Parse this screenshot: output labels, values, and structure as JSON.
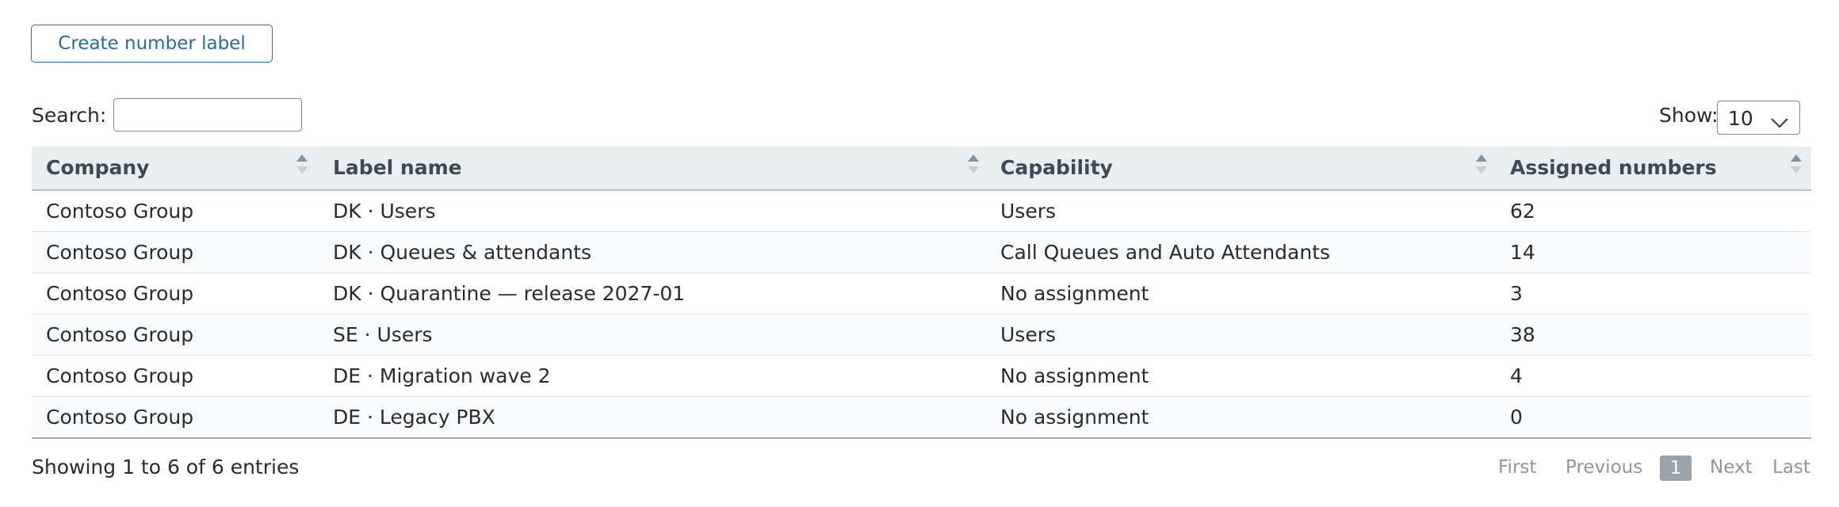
{
  "toolbar": {
    "create_label": "Create number label"
  },
  "search": {
    "label": "Search:",
    "value": "",
    "placeholder": ""
  },
  "page_size": {
    "label": "Show:",
    "value": "10"
  },
  "table": {
    "columns": [
      "Company",
      "Label name",
      "Capability",
      "Assigned numbers"
    ],
    "rows": [
      [
        "Contoso Group",
        "DK · Users",
        "Users",
        "62"
      ],
      [
        "Contoso Group",
        "DK · Queues & attendants",
        "Call Queues and Auto Attendants",
        "14"
      ],
      [
        "Contoso Group",
        "DK · Quarantine — release 2027-01",
        "No assignment",
        "3"
      ],
      [
        "Contoso Group",
        "SE · Users",
        "Users",
        "38"
      ],
      [
        "Contoso Group",
        "DE · Migration wave 2",
        "No assignment",
        "4"
      ],
      [
        "Contoso Group",
        "DE · Legacy PBX",
        "No assignment",
        "0"
      ]
    ]
  },
  "footer": {
    "info": "Showing 1 to 6 of 6 entries"
  },
  "pagination": {
    "first": "First",
    "previous": "Previous",
    "current": "1",
    "next": "Next",
    "last": "Last"
  },
  "icons": {
    "sort": "sort-both-icon",
    "chevron": "chevron-down-icon"
  },
  "colors": {
    "accent": "#2a6aa3",
    "header_bg": "#e9eef1",
    "pager_current_bg": "#9aa3ab"
  }
}
